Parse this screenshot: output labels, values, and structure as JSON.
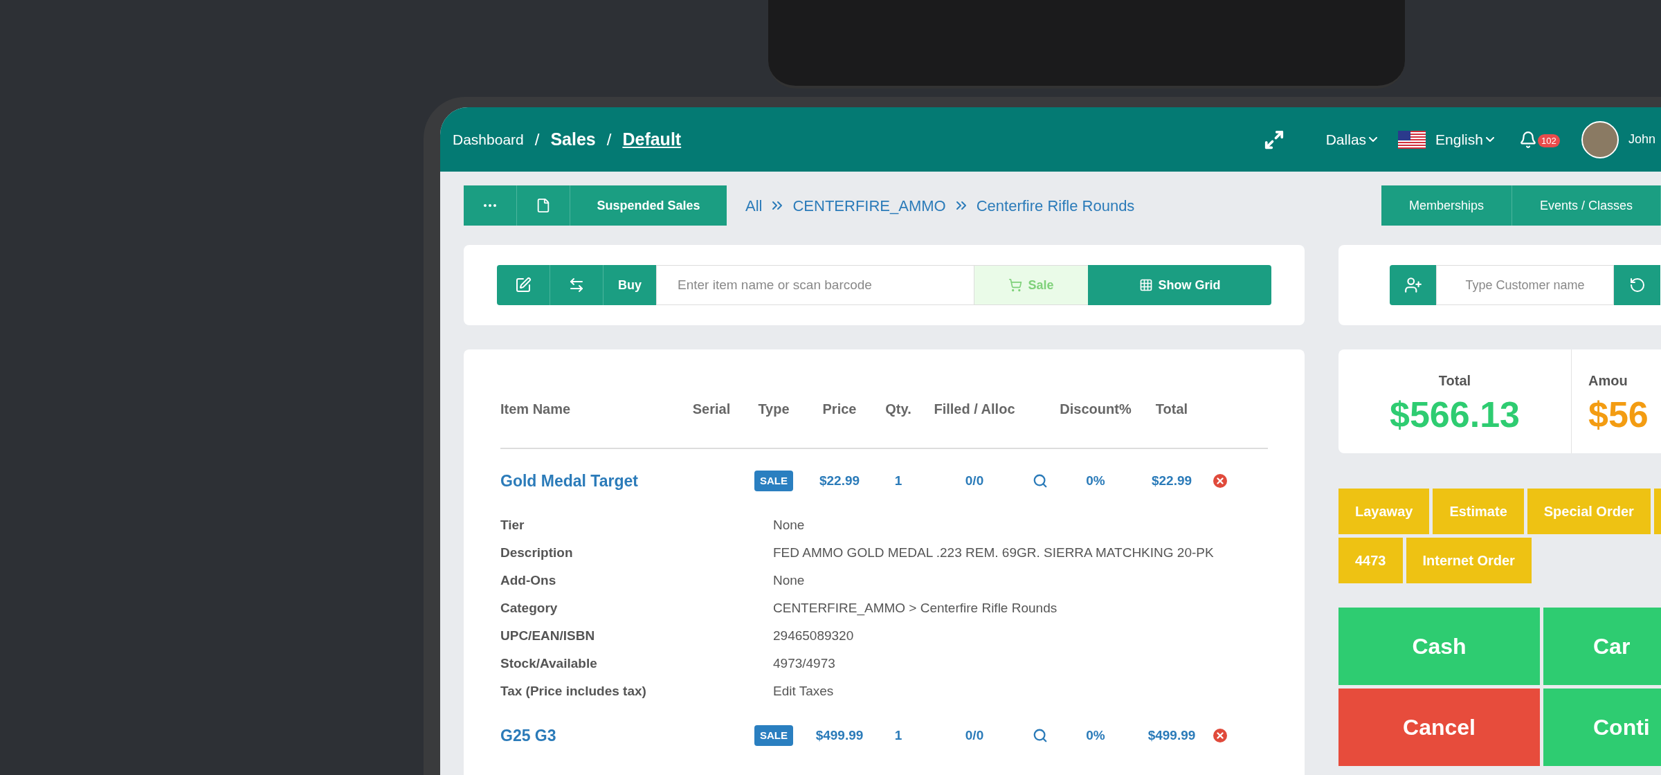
{
  "header": {
    "breadcrumb": [
      {
        "label": "Dashboard",
        "kind": "link"
      },
      {
        "label": "Sales",
        "kind": "section"
      },
      {
        "label": "Default",
        "kind": "current"
      }
    ],
    "separator": "/",
    "location": "Dallas",
    "language": "English",
    "notifications": "102",
    "user": "John"
  },
  "toolbar": {
    "suspended_label": "Suspended Sales",
    "path": [
      "All",
      "CENTERFIRE_AMMO",
      "Centerfire Rifle Rounds"
    ],
    "right_buttons": [
      "Memberships",
      "Events / Classes"
    ]
  },
  "item_bar": {
    "buy_label": "Buy",
    "placeholder": "Enter item name or scan barcode",
    "sale_label": "Sale",
    "grid_label": "Show Grid"
  },
  "customer": {
    "placeholder": "Type Customer name"
  },
  "table": {
    "columns": [
      "Item Name",
      "Serial",
      "Type",
      "Price",
      "Qty.",
      "Filled / Alloc",
      "Discount%",
      "Total"
    ],
    "rows": [
      {
        "name": "Gold Medal Target",
        "type": "SALE",
        "price": "$22.99",
        "qty": "1",
        "filled": "0/0",
        "discount": "0%",
        "total": "$22.99",
        "details": [
          {
            "label": "Tier",
            "value": "None"
          },
          {
            "label": "Description",
            "value": "FED AMMO GOLD MEDAL .223 REM. 69GR. SIERRA MATCHKING 20-PK"
          },
          {
            "label": "Add-Ons",
            "value": "None"
          },
          {
            "label": "Category",
            "value": "CENTERFIRE_AMMO > Centerfire Rifle Rounds"
          },
          {
            "label": "UPC/EAN/ISBN",
            "value": "29465089320"
          },
          {
            "label": "Stock/Available",
            "value": "4973/4973"
          },
          {
            "label": "Tax (Price includes tax)",
            "value": "Edit Taxes"
          }
        ]
      },
      {
        "name": "G25 G3",
        "type": "SALE",
        "price": "$499.99",
        "qty": "1",
        "filled": "0/0",
        "discount": "0%",
        "total": "$499.99"
      }
    ]
  },
  "summary": [
    {
      "label": "Total",
      "value": "$566.13",
      "color": "#2ecc71"
    },
    {
      "label": "Amou",
      "value": "$56",
      "color": "#f39c12"
    }
  ],
  "order_types": [
    "Layaway",
    "Estimate",
    "Special Order",
    "4473",
    "Internet Order"
  ],
  "payments": [
    {
      "label": "Cash",
      "kind": "pay"
    },
    {
      "label": "Car",
      "kind": "pay"
    },
    {
      "label": "Cancel",
      "kind": "cancel"
    },
    {
      "label": "Conti",
      "kind": "pay"
    }
  ]
}
